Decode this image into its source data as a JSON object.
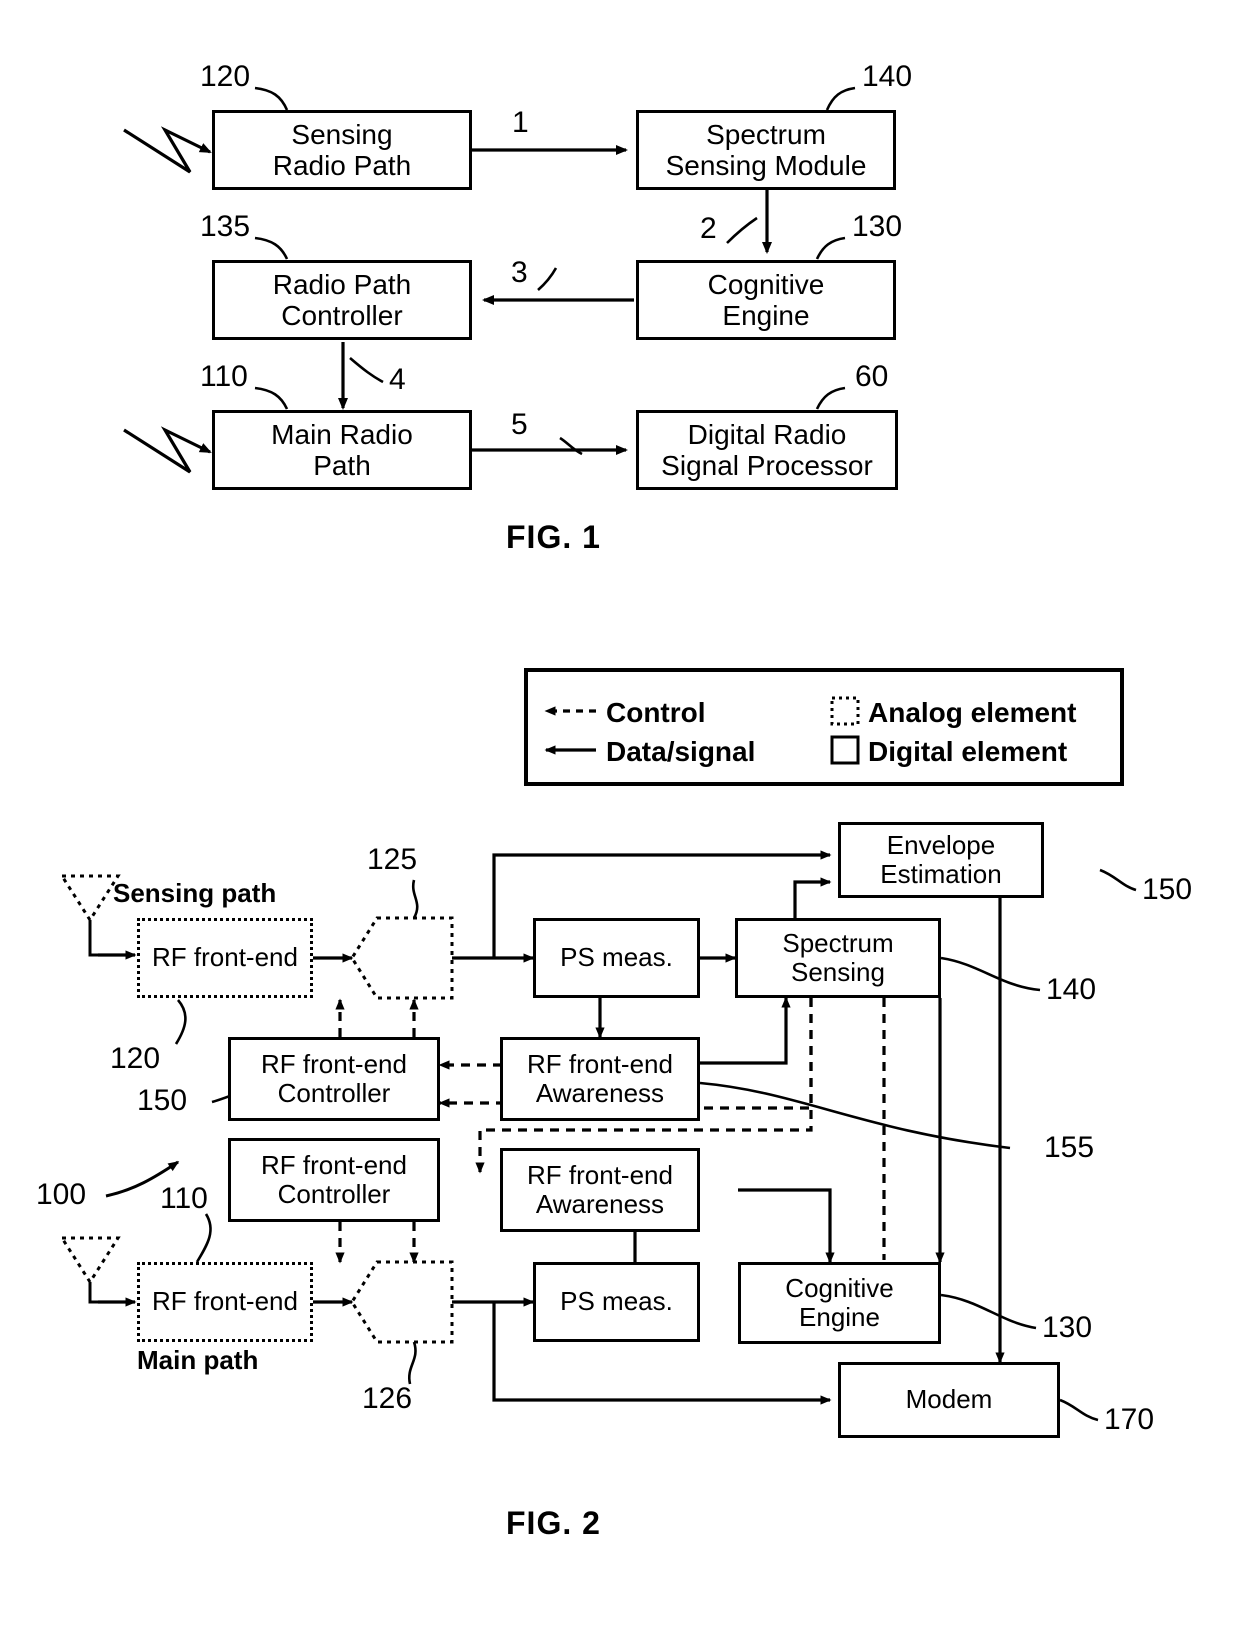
{
  "figure1": {
    "caption": "FIG. 1",
    "blocks": [
      {
        "id": "sensing-radio-path",
        "label": "Sensing\nRadio Path",
        "ref": "120"
      },
      {
        "id": "spectrum-sensing-module",
        "label": "Spectrum\nSensing Module",
        "ref": "140"
      },
      {
        "id": "radio-path-controller",
        "label": "Radio Path\nController",
        "ref": "135"
      },
      {
        "id": "cognitive-engine",
        "label": "Cognitive\nEngine",
        "ref": "130"
      },
      {
        "id": "main-radio-path",
        "label": "Main Radio\nPath",
        "ref": "110"
      },
      {
        "id": "digital-radio-signal-processor",
        "label": "Digital Radio\nSignal Processor",
        "ref": "60"
      }
    ],
    "connection_labels": [
      "1",
      "2",
      "3",
      "4",
      "5"
    ],
    "block_text": {
      "sensing_radio_path_line1": "Sensing",
      "sensing_radio_path_line2": "Radio Path",
      "spectrum_sensing_module_line1": "Spectrum",
      "spectrum_sensing_module_line2": "Sensing Module",
      "radio_path_controller_line1": "Radio Path",
      "radio_path_controller_line2": "Controller",
      "cognitive_engine_line1": "Cognitive",
      "cognitive_engine_line2": "Engine",
      "main_radio_path_line1": "Main Radio",
      "main_radio_path_line2": "Path",
      "digital_radio_signal_processor_line1": "Digital Radio",
      "digital_radio_signal_processor_line2": "Signal Processor"
    },
    "refs": {
      "sensing_radio_path": "120",
      "spectrum_sensing_module": "140",
      "radio_path_controller": "135",
      "cognitive_engine": "130",
      "main_radio_path": "110",
      "digital_radio_signal_processor": "60"
    },
    "arrow_numbers": {
      "a1": "1",
      "a2": "2",
      "a3": "3",
      "a4": "4",
      "a5": "5"
    }
  },
  "figure2": {
    "caption": "FIG. 2",
    "legend": {
      "control": "Control",
      "data_signal": "Data/signal",
      "analog_element": "Analog element",
      "digital_element": "Digital element"
    },
    "path_labels": {
      "sensing": "Sensing path",
      "main": "Main path"
    },
    "block_text": {
      "rf_front_end": "RF front-end",
      "rf_front_end_controller_line1": "RF front-end",
      "rf_front_end_controller_line2": "Controller",
      "rf_front_end_awareness_line1": "RF front-end",
      "rf_front_end_awareness_line2": "Awareness",
      "ps_meas": "PS meas.",
      "spectrum_sensing_line1": "Spectrum",
      "spectrum_sensing_line2": "Sensing",
      "envelope_estimation_line1": "Envelope",
      "envelope_estimation_line2": "Estimation",
      "cognitive_engine_line1": "Cognitive",
      "cognitive_engine_line2": "Engine",
      "modem": "Modem"
    },
    "refs": {
      "system": "100",
      "main_rf_front_end": "110",
      "sensing_rf_front_end": "120",
      "sensing_adc": "125",
      "main_adc": "126",
      "cognitive_engine": "130",
      "spectrum_sensing": "140",
      "rf_front_end_controller": "150",
      "envelope_estimation": "150",
      "awareness_link": "155",
      "modem": "170"
    }
  }
}
